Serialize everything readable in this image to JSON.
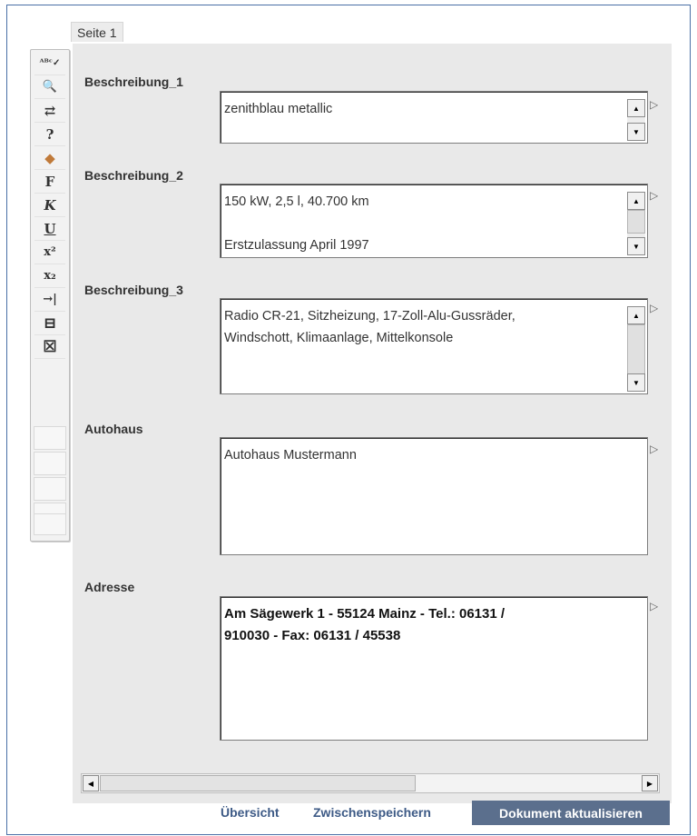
{
  "tab": {
    "label": "Seite 1"
  },
  "toolbar": {
    "buttons": [
      {
        "icon": "spellcheck-icon",
        "glyph": "ᴬᴮᶜ✓"
      },
      {
        "icon": "find-icon",
        "glyph": "🔍"
      },
      {
        "icon": "replace-icon",
        "glyph": "⇄"
      },
      {
        "icon": "help-icon",
        "glyph": "?"
      },
      {
        "icon": "eraser-icon",
        "glyph": "◆"
      },
      {
        "icon": "bold-icon",
        "glyph": "F"
      },
      {
        "icon": "italic-icon",
        "glyph": "K"
      },
      {
        "icon": "underline-icon",
        "glyph": "U"
      },
      {
        "icon": "superscript-icon",
        "glyph": "x²"
      },
      {
        "icon": "subscript-icon",
        "glyph": "x₂"
      },
      {
        "icon": "tab-icon",
        "glyph": "→|"
      },
      {
        "icon": "minus-box-icon",
        "glyph": "⊟"
      },
      {
        "icon": "close-box-icon",
        "glyph": "☒"
      }
    ]
  },
  "fields": [
    {
      "label": "Beschreibung_1",
      "value": "zenithblau metallic"
    },
    {
      "label": "Beschreibung_2",
      "value": "150 kW, 2,5 l, 40.700 km\n\nErstzulassung April 1997"
    },
    {
      "label": "Beschreibung_3",
      "value": "Radio CR-21, Sitzheizung, 17-Zoll-Alu-Gussräder,\nWindschott, Klimaanlage, Mittelkonsole"
    },
    {
      "label": "Autohaus",
      "value": "Autohaus Mustermann"
    },
    {
      "label": "Adresse",
      "value": "Am Sägewerk 1 - 55124 Mainz - Tel.: 06131 /\n910030 - Fax: 06131 / 45538"
    }
  ],
  "footer": {
    "overview": "Übersicht",
    "save_draft": "Zwischenspeichern",
    "update": "Dokument aktualisieren"
  },
  "colors": {
    "frame_border": "#4a6fa6",
    "footer_link": "#3d5a86",
    "primary_button": "#5b6f8d"
  }
}
